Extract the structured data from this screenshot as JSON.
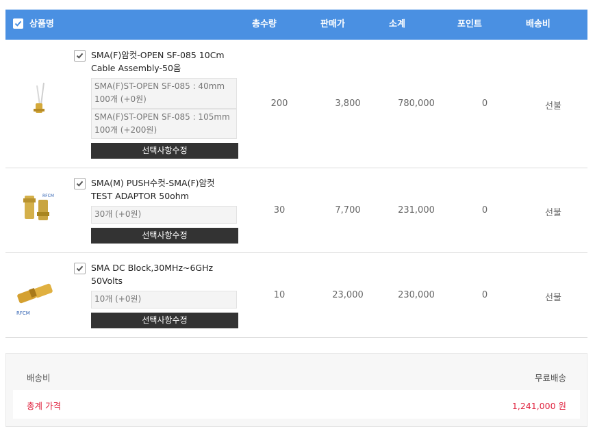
{
  "header": {
    "product_name": "상품명",
    "total_qty": "총수량",
    "sale_price": "판매가",
    "subtotal": "소계",
    "point": "포인트",
    "shipping": "배송비"
  },
  "products": [
    {
      "name": "SMA(F)암컷-OPEN SF-085 10Cm Cable Assembly-50옴",
      "options": [
        "SMA(F)ST-OPEN SF-085 : 40mm 100개 (+0원)",
        "SMA(F)ST-OPEN SF-085 : 105mm 100개 (+200원)"
      ],
      "edit_label": "선택사항수정",
      "qty": "200",
      "price": "3,800",
      "subtotal": "780,000",
      "point": "0",
      "shipping": "선불"
    },
    {
      "name": "SMA(M) PUSH수컷-SMA(F)암컷 TEST ADAPTOR 50ohm",
      "options": [
        "30개 (+0원)"
      ],
      "edit_label": "선택사항수정",
      "qty": "30",
      "price": "7,700",
      "subtotal": "231,000",
      "point": "0",
      "shipping": "선불"
    },
    {
      "name": "SMA DC Block,30MHz~6GHz 50Volts",
      "options": [
        "10개 (+0원)"
      ],
      "edit_label": "선택사항수정",
      "qty": "10",
      "price": "23,000",
      "subtotal": "230,000",
      "point": "0",
      "shipping": "선불"
    }
  ],
  "summary": {
    "shipping_label": "배송비",
    "shipping_value": "무료배송",
    "total_label": "총계 가격",
    "total_value": "1,241,000 원"
  },
  "colors": {
    "header_bg": "#4a90e2",
    "total_text": "#e0233f",
    "button_bg": "#333333"
  },
  "icons": {
    "checkbox": "checkmark-icon"
  }
}
